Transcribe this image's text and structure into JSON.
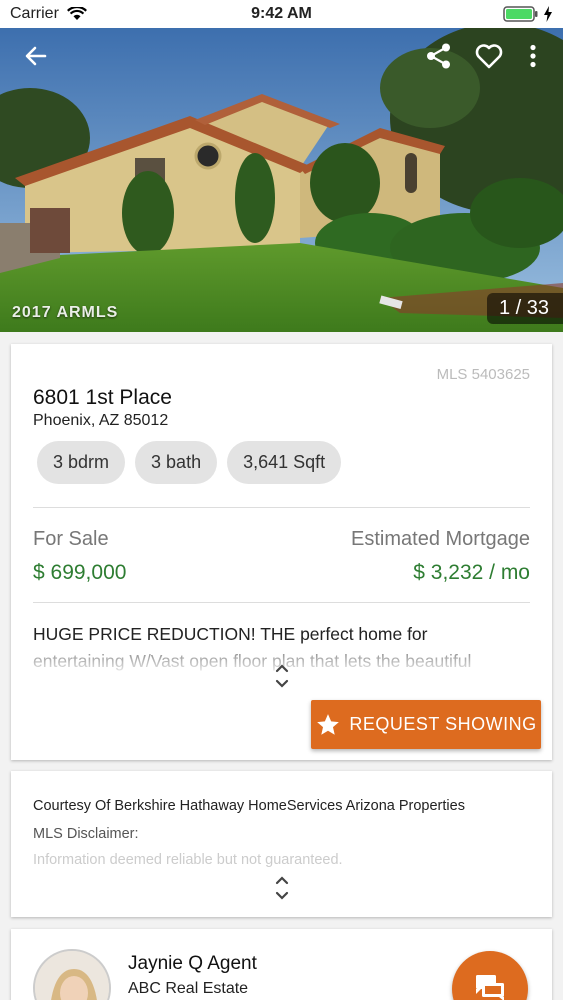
{
  "status_bar": {
    "carrier": "Carrier",
    "time": "9:42 AM"
  },
  "hero": {
    "watermark": "2017 ARMLS",
    "photo_counter": "1 / 33"
  },
  "listing": {
    "mls": "MLS 5403625",
    "address": "6801 1st Place",
    "city": "Phoenix, AZ 85012",
    "chips": [
      "3 bdrm",
      "3 bath",
      "3,641 Sqft"
    ],
    "status_label": "For Sale",
    "price": "$ 699,000",
    "mortgage_label": "Estimated Mortgage",
    "mortgage_value": "$ 3,232 / mo",
    "description_line1": "HUGE PRICE REDUCTION! THE perfect home for",
    "description_line2": "entertaining W/Vast open floor plan that lets the beautiful",
    "request_button": "REQUEST SHOWING"
  },
  "courtesy": {
    "text": "Courtesy Of Berkshire Hathaway HomeServices Arizona Properties",
    "disclaimer_label": "MLS Disclaimer:",
    "disclaimer_text": "Information deemed reliable but not guaranteed."
  },
  "agent": {
    "name": "Jaynie Q Agent",
    "company": "ABC Real Estate"
  },
  "colors": {
    "accent": "#dd6b1f",
    "price_green": "#2e7d32"
  }
}
